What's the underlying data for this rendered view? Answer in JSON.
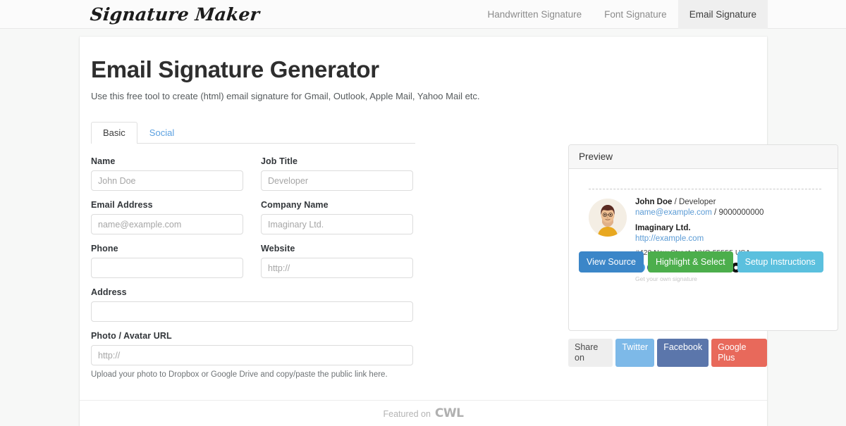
{
  "header": {
    "brand": "Signature Maker",
    "nav": [
      {
        "label": "Handwritten Signature",
        "active": false
      },
      {
        "label": "Font Signature",
        "active": false
      },
      {
        "label": "Email Signature",
        "active": true
      }
    ]
  },
  "main": {
    "title": "Email Signature Generator",
    "subtitle": "Use this free tool to create (html) email signature for Gmail, Outlook, Apple Mail, Yahoo Mail etc.",
    "tabs": [
      {
        "label": "Basic",
        "active": true
      },
      {
        "label": "Social",
        "active": false
      }
    ],
    "fields": {
      "name": {
        "label": "Name",
        "placeholder": "John Doe",
        "value": ""
      },
      "job_title": {
        "label": "Job Title",
        "placeholder": "Developer",
        "value": ""
      },
      "email": {
        "label": "Email Address",
        "placeholder": "name@example.com",
        "value": ""
      },
      "company": {
        "label": "Company Name",
        "placeholder": "Imaginary Ltd.",
        "value": ""
      },
      "phone": {
        "label": "Phone",
        "placeholder": "",
        "value": ""
      },
      "website": {
        "label": "Website",
        "placeholder": "http://",
        "value": ""
      },
      "address": {
        "label": "Address",
        "placeholder": "",
        "value": ""
      },
      "photo": {
        "label": "Photo / Avatar URL",
        "placeholder": "http://",
        "value": ""
      }
    },
    "help_text": "Upload your photo to Dropbox or Google Drive and copy/paste the public link here."
  },
  "preview": {
    "header": "Preview",
    "signature": {
      "name": "John Doe",
      "separator": " / ",
      "job_title": "Developer",
      "email": "name@example.com",
      "phone": "9000000000",
      "company": "Imaginary Ltd.",
      "website": "http://example.com",
      "address": "#420 New Street. NYC-55555 USA",
      "credit": "Get your own signature",
      "social_icons": [
        {
          "name": "twitter-icon",
          "glyph": "t",
          "color": "#4aa9e8"
        },
        {
          "name": "facebook-icon",
          "glyph": "f",
          "color": "#3b5998"
        },
        {
          "name": "google-plus-icon",
          "glyph": "g",
          "color": "#e3462f"
        },
        {
          "name": "linkedin-icon",
          "glyph": "in",
          "color": "#1b78b4"
        },
        {
          "name": "instagram-icon",
          "glyph": "▣",
          "color": "#7a9fbf"
        },
        {
          "name": "dribbble-icon",
          "glyph": "●",
          "color": "#ef5b92"
        },
        {
          "name": "youtube-icon",
          "glyph": "▶",
          "color": "#e04a3a"
        },
        {
          "name": "vimeo-icon",
          "glyph": "v",
          "color": "#6fc7e8"
        },
        {
          "name": "github-icon",
          "glyph": "●",
          "color": "#111111"
        },
        {
          "name": "wordpress-icon",
          "glyph": "W",
          "color": "#2a74a8"
        }
      ]
    },
    "buttons": [
      {
        "label": "View Source",
        "name": "view-source-button",
        "color": "#3b86c8"
      },
      {
        "label": "Highlight & Select",
        "name": "highlight-select-button",
        "color": "#4cae4c"
      },
      {
        "label": "Setup Instructions",
        "name": "setup-instructions-button",
        "color": "#5bc0de"
      }
    ]
  },
  "share": {
    "label": "Share on",
    "buttons": [
      {
        "label": "Twitter",
        "name": "share-twitter-button",
        "color": "#7db9e8"
      },
      {
        "label": "Facebook",
        "name": "share-facebook-button",
        "color": "#5b76ab"
      },
      {
        "label": "Google Plus",
        "name": "share-google-plus-button",
        "color": "#e8695b"
      }
    ]
  },
  "footer": {
    "featured_prefix": "Featured on",
    "featured_logo": "CWL"
  }
}
